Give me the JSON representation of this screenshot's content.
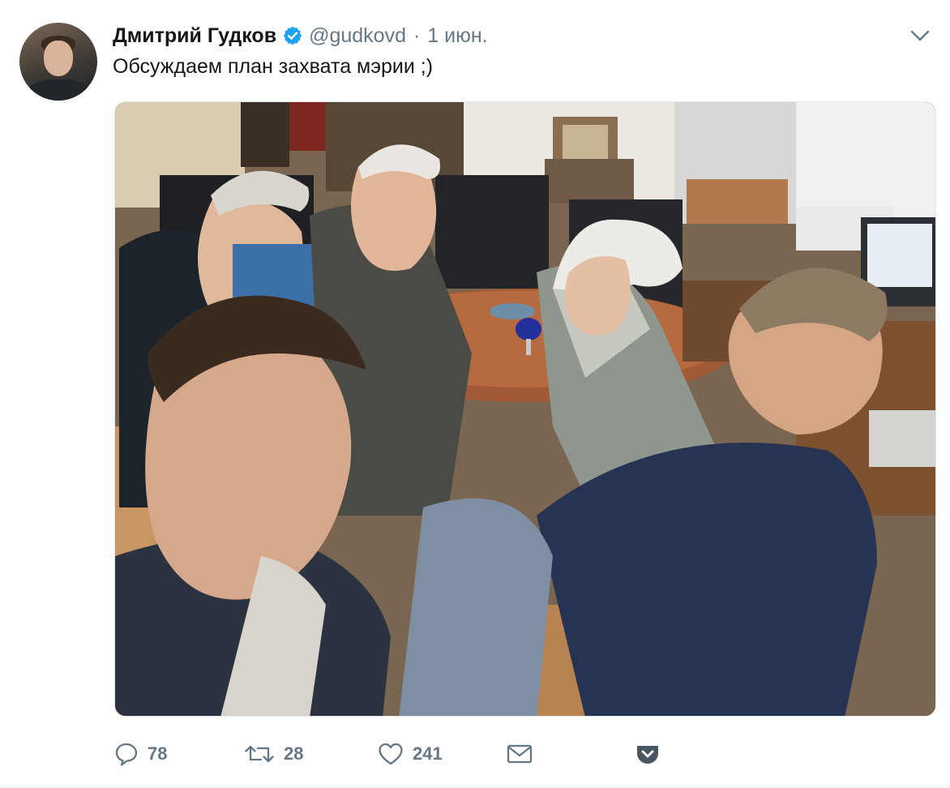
{
  "tweet": {
    "author_name": "Дмитрий Гудков",
    "handle": "@gudkovd",
    "separator": "·",
    "date": "1 июн.",
    "text": "Обсуждаем план захвата мэрии ;)",
    "verified": true
  },
  "actions": {
    "reply_count": "78",
    "retweet_count": "28",
    "like_count": "241"
  },
  "icons": {
    "reply": "reply-icon",
    "retweet": "retweet-icon",
    "like": "heart-icon",
    "message": "envelope-icon",
    "pocket": "pocket-icon",
    "caret": "chevron-down-icon",
    "verified": "verified-badge-icon"
  },
  "colors": {
    "text": "#14171a",
    "muted": "#657786",
    "verified": "#1da1f2",
    "pocket": "#4a5562"
  }
}
